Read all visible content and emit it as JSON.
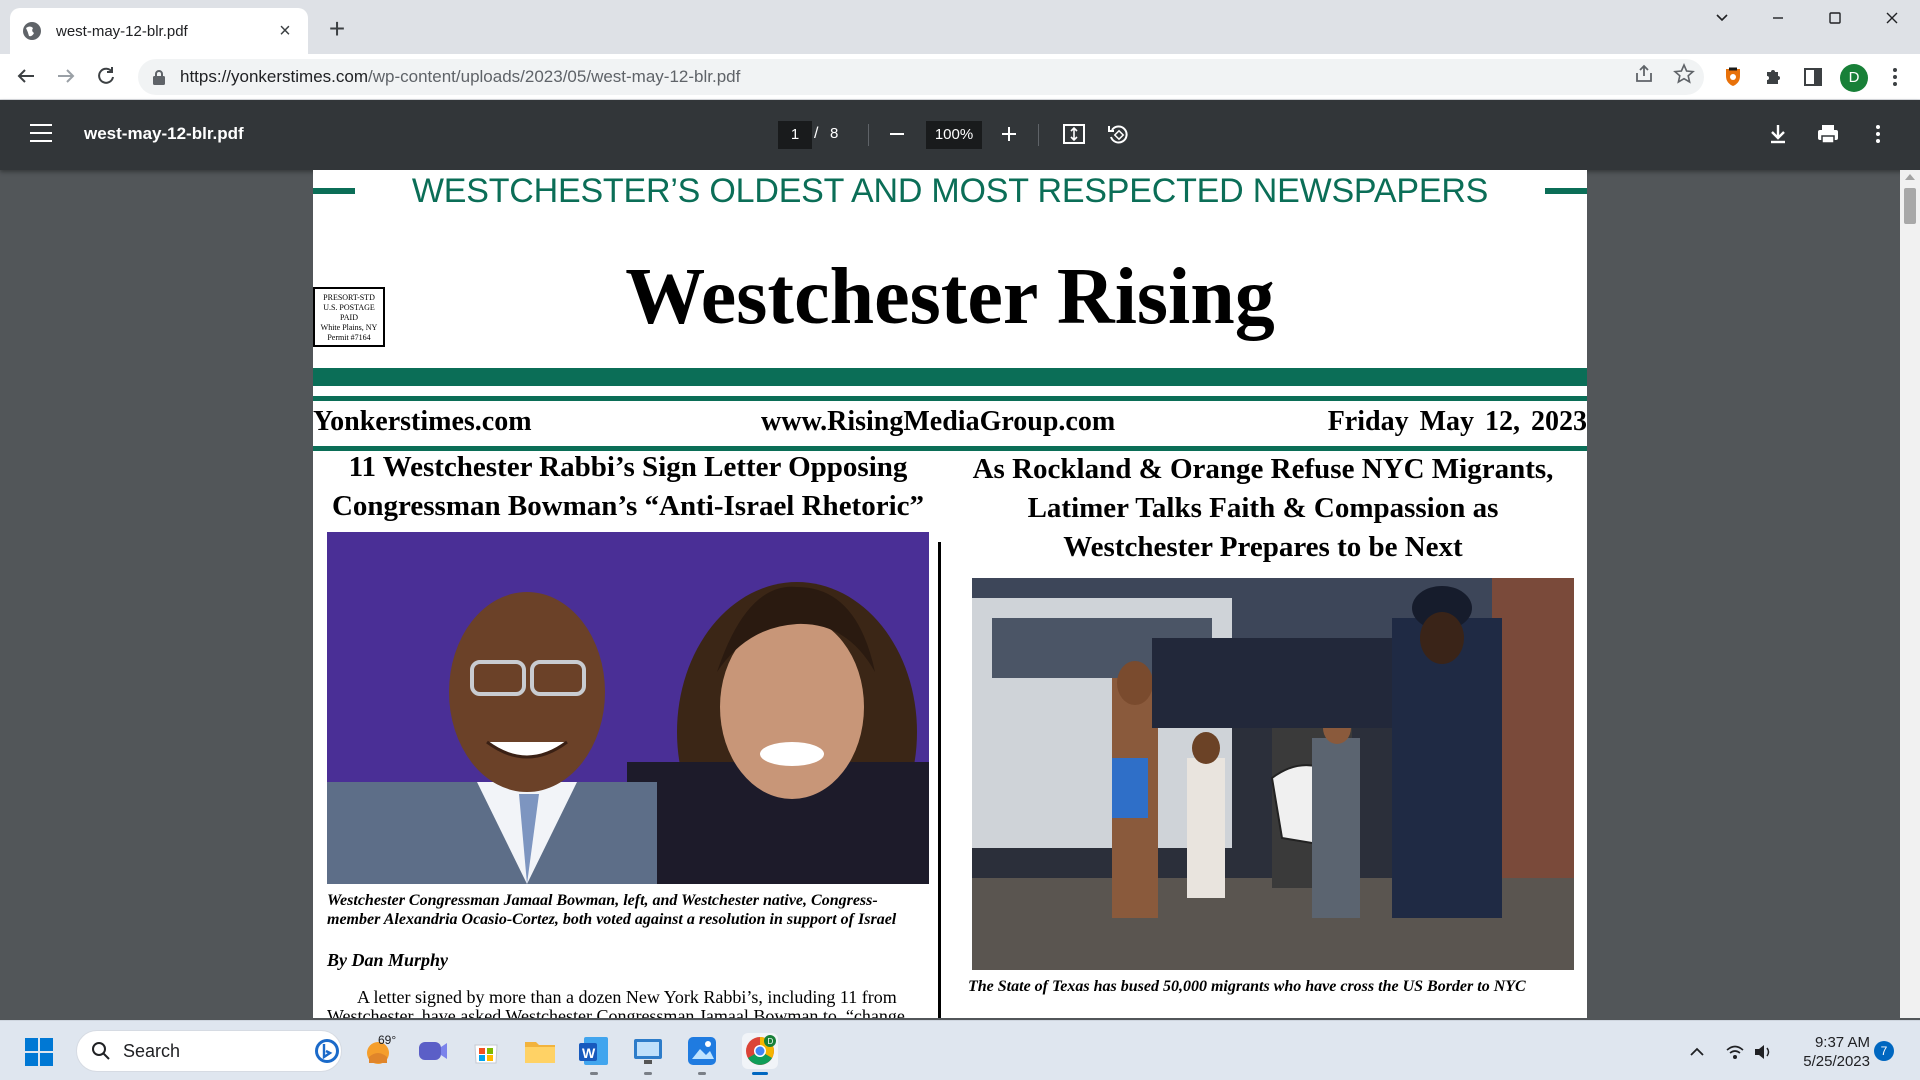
{
  "browser": {
    "tab_title": "west-may-12-blr.pdf",
    "url_host": "https://yonkerstimes.com",
    "url_path": "/wp-content/uploads/2023/05/west-may-12-blr.pdf",
    "profile_initial": "D"
  },
  "pdf_toolbar": {
    "file_name": "west-may-12-blr.pdf",
    "current_page": "1",
    "page_separator": "/",
    "total_pages": "8",
    "zoom": "100%"
  },
  "newspaper": {
    "tagline": "WESTCHESTER’S OLDEST AND MOST RESPECTED NEWSPAPERS",
    "masthead": "Westchester Rising",
    "postage": [
      "PRESORT-STD",
      "U.S. POSTAGE",
      "PAID",
      "White Plains, NY",
      "Permit #7164"
    ],
    "site_left": "Yonkerstimes.com",
    "site_center": "www.RisingMediaGroup.com",
    "date": "Friday May 12, 2023",
    "left_article": {
      "headline_1": "11 Westchester Rabbi’s Sign Letter Opposing",
      "headline_2": "Congressman Bowman’s “Anti-Israel Rhetoric”",
      "caption": "Westchester Congressman Jamaal Bowman, left, and Westchester native, Congress-member Alexandria Ocasio-Cortez, both voted against a resolution in support of Israel",
      "byline": "By Dan Murphy",
      "body": "A letter signed by more than a dozen New York Rabbi’s, including 11 from Westchester, have asked Westchester Congressman Jamaal Bowman to, “change"
    },
    "right_article": {
      "headline_1": "As Rockland & Orange Refuse NYC Migrants,",
      "headline_2": "Latimer Talks Faith & Compassion as",
      "headline_3": "Westchester Prepares to be Next",
      "caption": "The State of Texas has bused 50,000 migrants who have cross the US Border to NYC"
    }
  },
  "taskbar": {
    "search_label": "Search",
    "weather_temp": "69°",
    "time": "9:37 AM",
    "date": "5/25/2023",
    "notification_count": "7"
  },
  "colors": {
    "newspaper_green": "#0b6e57",
    "pdf_toolbar": "#323639",
    "viewer_background": "#525659",
    "taskbar": "#dfe6ef"
  }
}
